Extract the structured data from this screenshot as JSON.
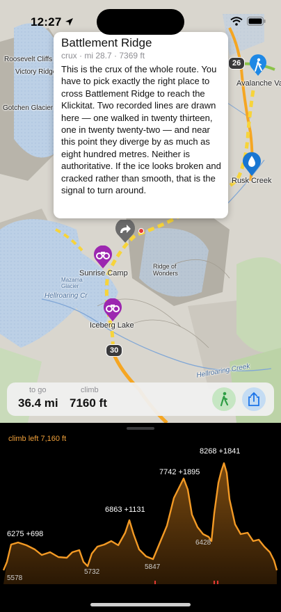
{
  "status": {
    "time": "12:27"
  },
  "card": {
    "title": "Battlement Ridge",
    "subtitle": "crux · mi 28.7 · 7369 ft",
    "body": "This is the crux of the whole route. You have to pick exactly the right place to cross Battlement Ridge to reach the Klickitat. Two recorded lines are drawn here — one walked in twenty thirteen, one in twenty twenty-two — and near this point they diverge by as much as eight hundred metres. Neither is authoritative. If the ice looks broken and cracked rather than smooth, that is the signal to turn around."
  },
  "map": {
    "labels": {
      "avalanche": "Avalanche Va",
      "rusk_creek": "Rusk Creek",
      "sunrise_camp": "Sunrise Camp",
      "iceberg_lake": "Iceberg Lake",
      "ridge_of_wonders": "Ridge of Wonders",
      "hellroaring_creek_1": "Hellroaring Cr",
      "hellroaring_creek_2": "Hellroaring Creek",
      "mazama_glacier": "Mazama Glacier",
      "roosevelt_cliffs": "Roosevelt Cliffs",
      "victory_ridge": "Victory Ridge",
      "gotchen_glacier": "Gotchen Glacier"
    },
    "mile_markers": [
      "26",
      "30"
    ],
    "icons": {
      "waypoint": "hiker-icon",
      "water": "water-drop-icon",
      "camp": "binoculars-icon",
      "turn": "turn-arrow-icon"
    }
  },
  "stats": {
    "to_go_label": "to go",
    "to_go_value": "36.4 mi",
    "climb_label": "climb",
    "climb_value": "7160 ft"
  },
  "elevation": {
    "climb_left": "climb left 7,160 ft",
    "peak_labels": [
      {
        "text": "6275 +698"
      },
      {
        "text": "6863 +1131"
      },
      {
        "text": "7742 +1895"
      },
      {
        "text": "8268 +1841"
      }
    ],
    "low_labels": [
      "5578",
      "5732",
      "5847",
      "6428"
    ],
    "accent": "#f39a25"
  }
}
